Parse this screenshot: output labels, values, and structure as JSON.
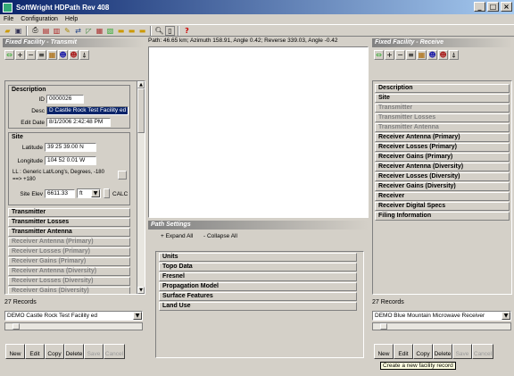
{
  "window": {
    "title": "SoftWright HDPath Rev 408"
  },
  "menu": [
    "File",
    "Configuration",
    "Help"
  ],
  "status_path": "Path: 46.65 km; Azimuth 158.91, Angle 0.42; Reverse 339.03, Angle -0.42",
  "left": {
    "header": "Fixed Facility - Transmit",
    "description_title": "Description",
    "id_label": "ID",
    "id_value": "0000026",
    "desc_label": "Desc",
    "desc_value": "D Castle Rock Test Facility ed",
    "edit_date_label": "Edit Date",
    "edit_date_value": "8/1/2006 2:42:48 PM",
    "site_title": "Site",
    "lat_label": "Latitude",
    "lat_value": "39 25 39.00 N",
    "lon_label": "Longitude",
    "lon_value": "104 52 0.01 W",
    "ll_text": "LL : Generic Lat/Long's, Degrees, -180 ==> +180",
    "elev_label": "Site Elev",
    "elev_value": "6611.33",
    "elev_unit": "ft",
    "calc_label": "CALC",
    "sections": [
      {
        "label": "Transmitter",
        "dim": false
      },
      {
        "label": "Transmitter Losses",
        "dim": false
      },
      {
        "label": "Transmitter Antenna",
        "dim": false
      },
      {
        "label": "Receiver Antenna (Primary)",
        "dim": true
      },
      {
        "label": "Receiver Losses (Primary)",
        "dim": true
      },
      {
        "label": "Receiver Gains (Primary)",
        "dim": true
      },
      {
        "label": "Receiver Antenna (Diversity)",
        "dim": true
      },
      {
        "label": "Receiver Losses (Diversity)",
        "dim": true
      },
      {
        "label": "Receiver Gains (Diversity)",
        "dim": true
      }
    ],
    "records": "27 Records",
    "combo_value": "DEMO Castle Rock Test Facility ed",
    "buttons": [
      "New",
      "Edit",
      "Copy",
      "Delete",
      "Save",
      "Cancel"
    ]
  },
  "right": {
    "header": "Fixed Facility - Receive",
    "sections": [
      {
        "label": "Description",
        "dim": false
      },
      {
        "label": "Site",
        "dim": false
      },
      {
        "label": "Transmitter",
        "dim": true
      },
      {
        "label": "Transmitter Losses",
        "dim": true
      },
      {
        "label": "Transmitter Antenna",
        "dim": true
      },
      {
        "label": "Receiver Antenna (Primary)",
        "dim": false
      },
      {
        "label": "Receiver Losses (Primary)",
        "dim": false
      },
      {
        "label": "Receiver Gains (Primary)",
        "dim": false
      },
      {
        "label": "Receiver Antenna (Diversity)",
        "dim": false
      },
      {
        "label": "Receiver Losses (Diversity)",
        "dim": false
      },
      {
        "label": "Receiver Gains (Diversity)",
        "dim": false
      },
      {
        "label": "Receiver",
        "dim": false
      },
      {
        "label": "Receiver Digital Specs",
        "dim": false
      },
      {
        "label": "Filing Information",
        "dim": false
      }
    ],
    "records": "27 Records",
    "combo_value": "DEMO Blue Mountain Microwave Receiver",
    "buttons": [
      "New",
      "Edit",
      "Copy",
      "Delete",
      "Save",
      "Cancel"
    ],
    "tooltip": "Create a new facility record"
  },
  "path_settings": {
    "title": "Path Settings",
    "expand_all": "+ Expand All",
    "collapse_all": "- Collapse All",
    "items": [
      "Units",
      "Topo Data",
      "Fresnel",
      "Propagation Model",
      "Surface Features",
      "Land Use"
    ]
  }
}
